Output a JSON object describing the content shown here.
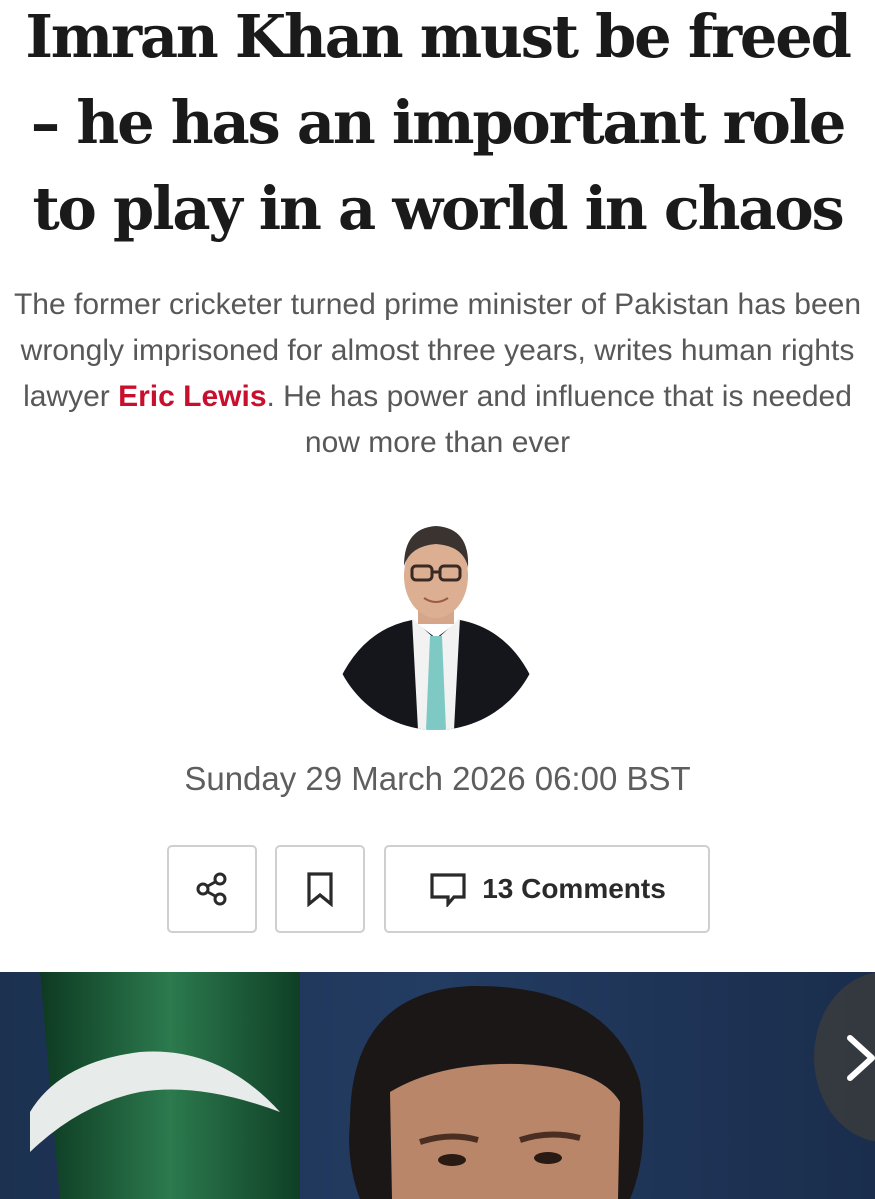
{
  "headline": {
    "line1": "Imran Khan must be freed",
    "line2": "– he has an important role",
    "line3": "to play in a world in chaos"
  },
  "standfirst": {
    "before_author": "The former cricketer turned prime minister of Pakistan has been wrongly imprisoned for almost three years, writes human rights lawyer ",
    "author": "Eric Lewis",
    "after_author": ". He has power and influence that is needed now more than ever"
  },
  "dateline": "Sunday 29 March 2026 06:00 BST",
  "actions": {
    "share_icon": "share-icon",
    "bookmark_icon": "bookmark-icon",
    "comment_icon": "comment-icon",
    "comments_label": "13 Comments"
  },
  "colors": {
    "author_link": "#c8102e",
    "headline": "#1a1a1a",
    "standfirst": "#585858",
    "button_border": "#cfcfcf"
  }
}
